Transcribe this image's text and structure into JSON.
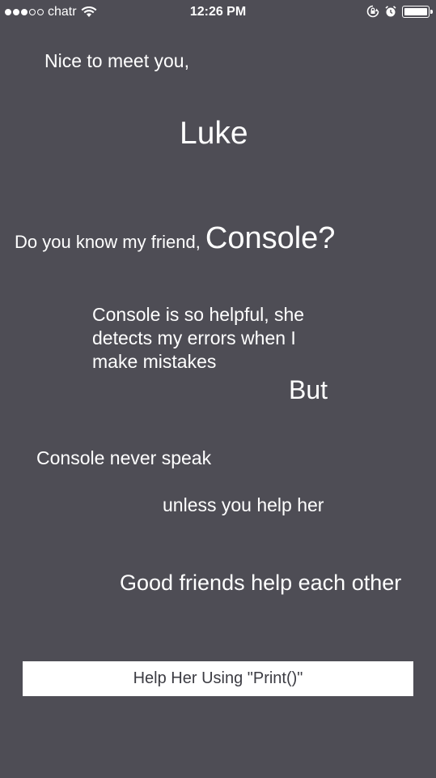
{
  "status_bar": {
    "carrier": "chatr",
    "time": "12:26 PM",
    "icons": [
      "signal-dots-icon",
      "wifi-icon",
      "orientation-lock-icon",
      "alarm-icon",
      "battery-icon"
    ]
  },
  "content": {
    "greeting": "Nice to meet you,",
    "name": "Luke",
    "friend_question_lead": "Do you know my friend,",
    "friend_name": "Console?",
    "helpful_text": "Console is so helpful, she detects my errors when I make mistakes",
    "but": "But",
    "never_speak": "Console never speak",
    "unless": "unless you help her",
    "good_friends": "Good friends help each other"
  },
  "actions": {
    "help_button_label": "Help Her Using \"Print()\""
  },
  "colors": {
    "background": "#4e4d55",
    "text": "#ffffff",
    "button_bg": "#ffffff",
    "button_text": "#3c3c43"
  }
}
